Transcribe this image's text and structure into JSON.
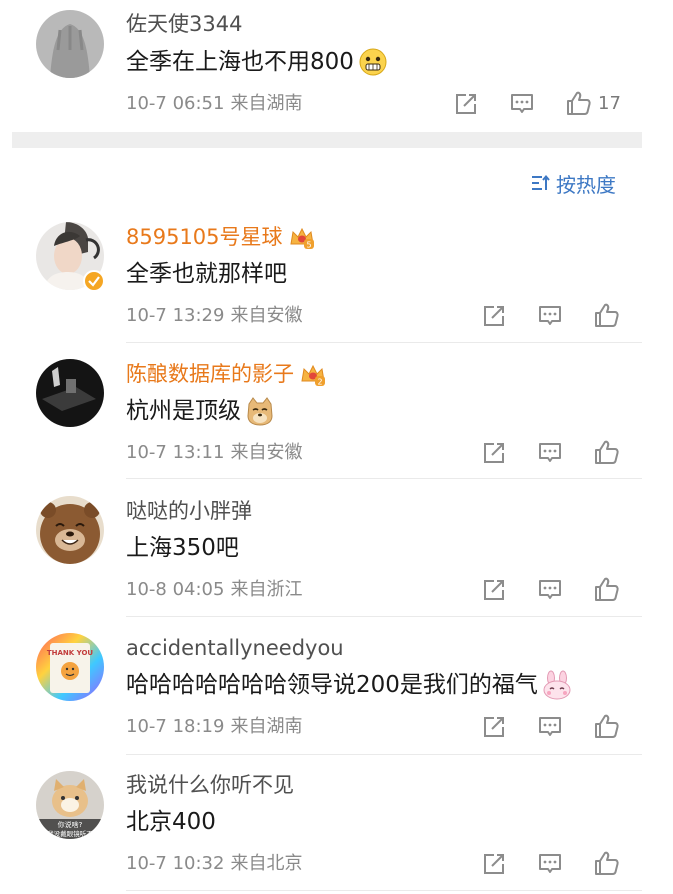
{
  "top_comment": {
    "username": "佐天使3344",
    "text": "全季在上海也不用800",
    "time": "10-7 06:51",
    "source": "来自湖南",
    "likes": "17"
  },
  "sort": {
    "label": "按热度"
  },
  "comments": [
    {
      "username": "8595105号星球",
      "badge_level": "5",
      "text": "全季也就那样吧",
      "time": "10-7 13:29",
      "source": "来自安徽"
    },
    {
      "username": "陈酿数据库的影子",
      "badge_level": "2",
      "text": "杭州是顶级",
      "time": "10-7 13:11",
      "source": "来自安徽"
    },
    {
      "username": "哒哒的小胖弹",
      "text": "上海350吧",
      "time": "10-8 04:05",
      "source": "来自浙江"
    },
    {
      "username": "accidentallyneedyou",
      "text": "哈哈哈哈哈哈哈领导说200是我们的福气",
      "time": "10-7 18:19",
      "source": "来自湖南"
    },
    {
      "username": "我说什么你听不见",
      "text": "北京400",
      "time": "10-7 10:32",
      "source": "来自北京"
    }
  ],
  "avatar_texts": {
    "thank_you": "THANK YOU",
    "cat_caption_1": "你说啥?",
    "cat_caption_2": "我没戴眼镜听不"
  },
  "colors": {
    "accent_blue": "#3d78c4",
    "vip_orange": "#e8791b",
    "meta_gray": "#8a8a8a",
    "icon_gray": "#8c8c8c"
  },
  "icons": [
    "repost-icon",
    "comment-icon",
    "like-icon",
    "crown-badge-icon",
    "sort-icon"
  ]
}
